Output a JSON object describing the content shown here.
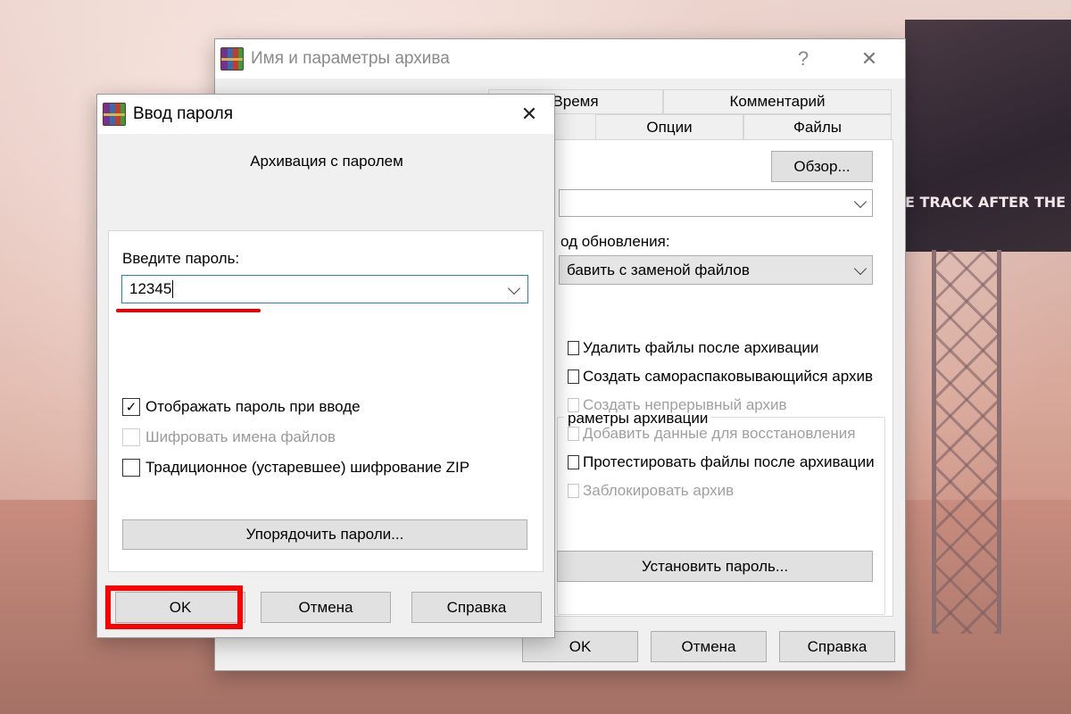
{
  "background": {
    "screen_text": "E TRACK AFTER THE"
  },
  "archive_dialog": {
    "title": "Имя и параметры архива",
    "help_glyph": "?",
    "close_glyph": "✕",
    "tabs_row1": [
      "Время",
      "Комментарий"
    ],
    "tabs_row2": [
      "Опции",
      "Файлы"
    ],
    "browse_label": "Обзор...",
    "update_mode_label": "од обновления:",
    "update_mode_value": "бавить с заменой файлов",
    "options_group_title": "раметры архивации",
    "options": [
      {
        "label": "Удалить файлы после архивации",
        "enabled": true
      },
      {
        "label": "Создать самораспаковывающийся архив",
        "enabled": true
      },
      {
        "label": "Создать непрерывный архив",
        "enabled": false
      },
      {
        "label": "Добавить данные для восстановления",
        "enabled": false
      },
      {
        "label": "Протестировать файлы после архивации",
        "enabled": true
      },
      {
        "label": "Заблокировать архив",
        "enabled": false
      }
    ],
    "set_password_label": "Установить пароль...",
    "ok_label": "OK",
    "cancel_label": "Отмена",
    "help_label": "Справка"
  },
  "password_dialog": {
    "title": "Ввод пароля",
    "close_glyph": "✕",
    "heading": "Архивация с паролем",
    "enter_password_label": "Введите пароль:",
    "password_value": "12345",
    "checkboxes": [
      {
        "label": "Отображать пароль при вводе",
        "checked": true,
        "enabled": true
      },
      {
        "label": "Шифровать имена файлов",
        "checked": false,
        "enabled": false
      },
      {
        "label": "Традиционное (устаревшее) шифрование ZIP",
        "checked": false,
        "enabled": true
      }
    ],
    "organize_label": "Упорядочить пароли...",
    "ok_label": "OK",
    "cancel_label": "Отмена",
    "help_label": "Справка"
  },
  "colors": {
    "highlight": "#ff0000",
    "focus_border": "#2a7bd6"
  }
}
